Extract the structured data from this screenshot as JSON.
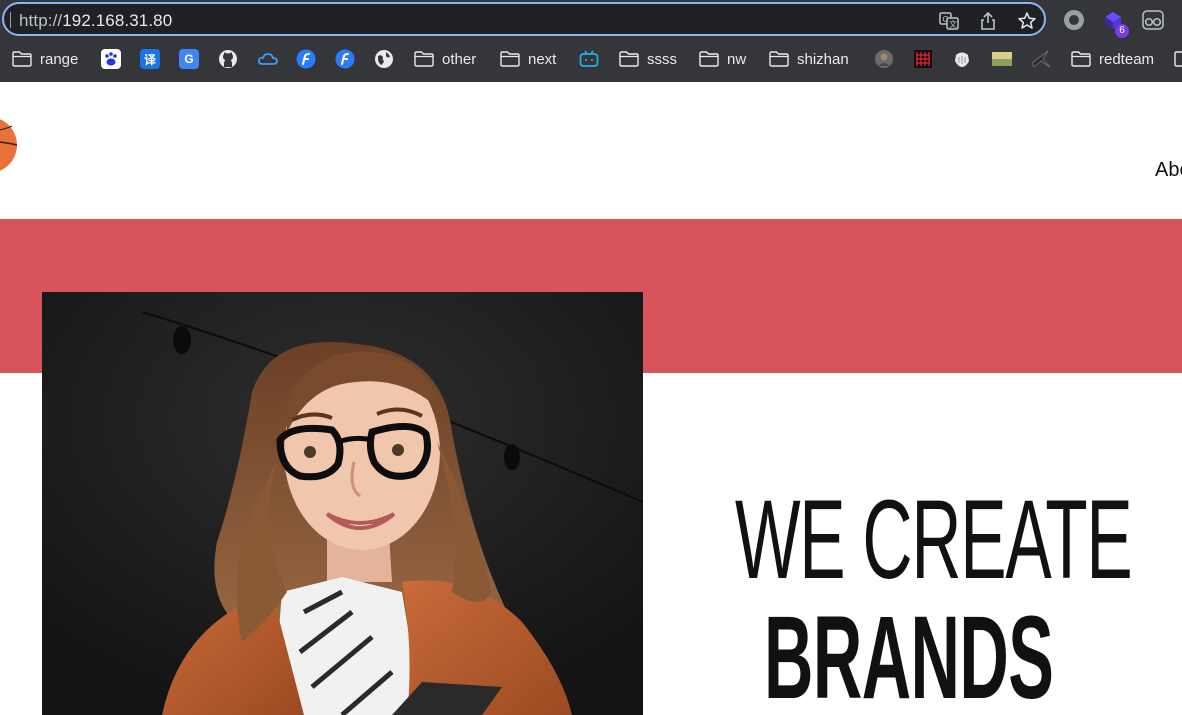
{
  "browser": {
    "url_protocol": "http://",
    "url_host": "192.168.31.80",
    "extension_badge_count": "6"
  },
  "bookmarks": [
    {
      "type": "folder",
      "label": "range"
    },
    {
      "type": "icon",
      "icon": "baidu-paw-icon"
    },
    {
      "type": "icon",
      "icon": "translate-yi-icon",
      "glyph": "译"
    },
    {
      "type": "icon",
      "icon": "google-translate-icon",
      "glyph": "G"
    },
    {
      "type": "icon",
      "icon": "github-icon"
    },
    {
      "type": "icon",
      "icon": "cloud-icon"
    },
    {
      "type": "icon",
      "icon": "blue-f-icon"
    },
    {
      "type": "icon",
      "icon": "blue-f-icon"
    },
    {
      "type": "icon",
      "icon": "globe-icon"
    },
    {
      "type": "folder",
      "label": "other"
    },
    {
      "type": "folder",
      "label": "next"
    },
    {
      "type": "icon",
      "icon": "bilibili-tv-icon"
    },
    {
      "type": "folder",
      "label": "ssss"
    },
    {
      "type": "folder",
      "label": "nw"
    },
    {
      "type": "folder",
      "label": "shizhan"
    },
    {
      "type": "icon",
      "icon": "avatar-thumb-icon"
    },
    {
      "type": "icon",
      "icon": "red-grid-icon"
    },
    {
      "type": "icon",
      "icon": "white-creature-icon"
    },
    {
      "type": "icon",
      "icon": "thumbnail-icon"
    },
    {
      "type": "icon",
      "icon": "dark-bird-icon"
    },
    {
      "type": "folder",
      "label": "redteam"
    }
  ],
  "site": {
    "nav_about": "Abo",
    "headline_light": "WE CREATE",
    "headline_bold": "BRANDS"
  },
  "colors": {
    "accent_band": "#d9535b",
    "chrome_bg": "#35363a",
    "address_focus": "#8ab4f8"
  }
}
